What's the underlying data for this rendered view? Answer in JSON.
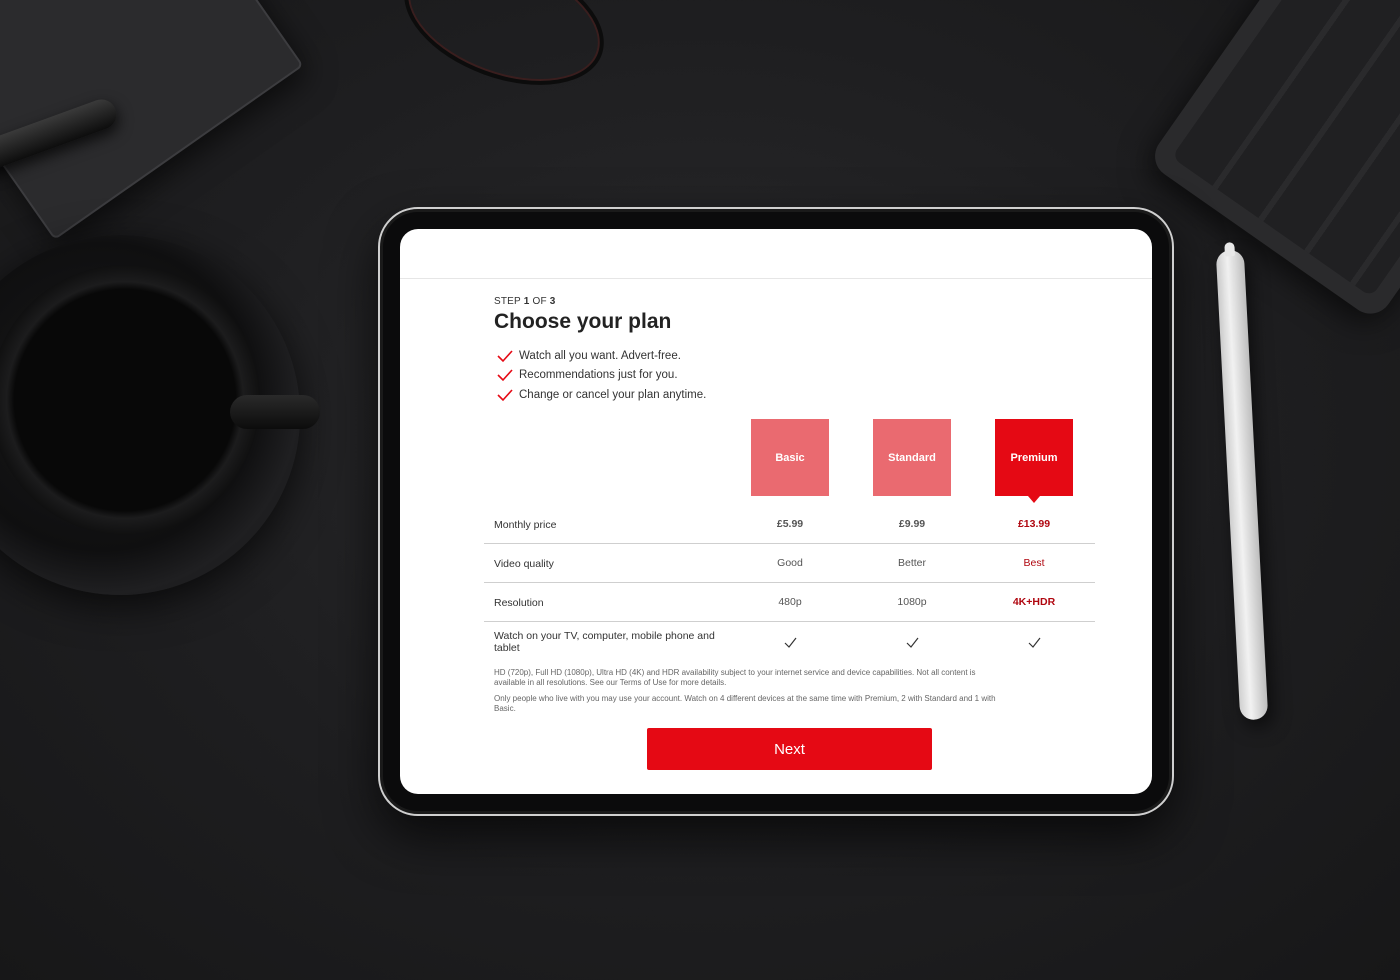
{
  "header": {
    "step_prefix": "STEP",
    "step_current": "1",
    "step_of": "OF",
    "step_total": "3",
    "title": "Choose your plan"
  },
  "benefits": [
    "Watch all you want. Advert-free.",
    "Recommendations just for you.",
    "Change or cancel your plan anytime."
  ],
  "plans": [
    {
      "name": "Basic",
      "selected": false
    },
    {
      "name": "Standard",
      "selected": false
    },
    {
      "name": "Premium",
      "selected": true
    }
  ],
  "rows": [
    {
      "label": "Monthly price",
      "values": [
        "£5.99",
        "£9.99",
        "£13.99"
      ]
    },
    {
      "label": "Video quality",
      "values": [
        "Good",
        "Better",
        "Best"
      ]
    },
    {
      "label": "Resolution",
      "values": [
        "480p",
        "1080p",
        "4K+HDR"
      ]
    },
    {
      "label": "Watch on your TV, computer, mobile phone and tablet",
      "values": [
        "check-icon",
        "check-icon",
        "check-icon"
      ]
    }
  ],
  "fineprint": [
    "HD (720p), Full HD (1080p), Ultra HD (4K) and HDR availability subject to your internet service and device capabilities. Not all content is available in all resolutions. See our Terms of Use for more details.",
    "Only people who live with you may use your account. Watch on 4 different devices at the same time with Premium, 2 with Standard and 1 with Basic."
  ],
  "actions": {
    "next_label": "Next"
  },
  "colors": {
    "brand_red": "#e50914",
    "inactive_plan": "#ea6a70",
    "selected_text": "#b00710"
  }
}
